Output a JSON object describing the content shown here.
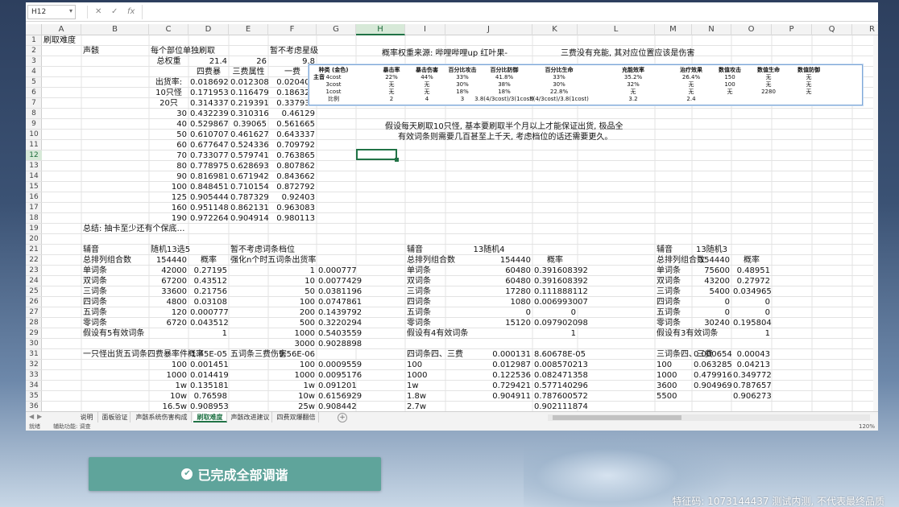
{
  "formula_bar": {
    "name_box": "H12",
    "fx": "fx"
  },
  "columns": [
    "A",
    "B",
    "C",
    "D",
    "E",
    "F",
    "G",
    "H",
    "I",
    "J",
    "K",
    "L",
    "M",
    "N",
    "O",
    "P",
    "Q",
    "R",
    "S",
    "T"
  ],
  "active_cell": "H12",
  "rows": [
    "1",
    "2",
    "3",
    "4",
    "5",
    "6",
    "7",
    "8",
    "9",
    "10",
    "11",
    "12",
    "13",
    "14",
    "15",
    "16",
    "17",
    "18",
    "19",
    "20",
    "21",
    "22",
    "23",
    "24",
    "25",
    "26",
    "27",
    "28",
    "29",
    "30",
    "31",
    "32",
    "33",
    "34",
    "35",
    "36"
  ],
  "cells": {
    "A1": "刷取难度",
    "B2": "声骸",
    "C2": "每个部位单独刷取",
    "F2": "暂不考虑星级",
    "C3": "总权重",
    "D3": "21.4",
    "E3": "26",
    "F3": "9.8",
    "D4": "四费暴",
    "E4": "三费属性",
    "F4": "一费",
    "C5": "出货率:",
    "D5": "0.018692",
    "E5": "0.012308",
    "F5": "0.020408",
    "C6": "10只怪",
    "D6": "0.171953",
    "E6": "0.116479",
    "F6": "0.186324",
    "C7": "20只",
    "D7": "0.314337",
    "E7": "0.219391",
    "F7": "0.337931",
    "C8": "30",
    "D8": "0.432239",
    "E8": "0.310316",
    "F8": "0.46129",
    "C9": "40",
    "D9": "0.529867",
    "E9": "0.39065",
    "F9": "0.561665",
    "C10": "50",
    "D10": "0.610707",
    "E10": "0.461627",
    "F10": "0.643337",
    "C11": "60",
    "D11": "0.677647",
    "E11": "0.524336",
    "F11": "0.709792",
    "C12": "70",
    "D12": "0.733077",
    "E12": "0.579741",
    "F12": "0.763865",
    "C13": "80",
    "D13": "0.778975",
    "E13": "0.628693",
    "F13": "0.807862",
    "C14": "90",
    "D14": "0.816981",
    "E14": "0.671942",
    "F14": "0.843662",
    "C15": "100",
    "D15": "0.848451",
    "E15": "0.710154",
    "F15": "0.872792",
    "C16": "125",
    "D16": "0.905444",
    "E16": "0.787329",
    "F16": "0.92403",
    "C17": "160",
    "D17": "0.951148",
    "E17": "0.862131",
    "F17": "0.963083",
    "C18": "190",
    "D18": "0.972264",
    "E18": "0.904914",
    "F18": "0.980113",
    "B20": "总结: 抽卡至少还有个保底…",
    "B22": "辅音",
    "C22": "随机13选5",
    "E22": "暂不考虑词条档位",
    "B23": "总排列组合数",
    "C23": "154440",
    "D23": "概率",
    "E23": "强化n个时五词条出货率",
    "B24": "单词条",
    "C24": "42000",
    "D24": "0.27195",
    "F24": "1",
    "F24b": "0.000777",
    "B25": "双词条",
    "C25": "67200",
    "D25": "0.43512",
    "F25": "10",
    "F25b": "0.0077429",
    "B26": "三词条",
    "C26": "33600",
    "D26": "0.21756",
    "F26": "50",
    "F26b": "0.0381196",
    "B27": "四词条",
    "C27": "4800",
    "D27": "0.03108",
    "F27": "100",
    "F27b": "0.0747861",
    "B28": "五词条",
    "C28": "120",
    "D28": "0.000777",
    "F28": "200",
    "F28b": "0.1439792",
    "B29": "零词条",
    "C29": "6720",
    "D29": "0.043512",
    "F29": "500",
    "F29b": "0.3220294",
    "B30": "假设有5有效词条",
    "D30": "1",
    "F30": "1000",
    "F30b": "0.5403559",
    "F31": "3000",
    "F31b": "0.9028898",
    "B32": "一只怪出货五词条四费暴率件概率",
    "D32": "1.45E-05",
    "E32": "五词条三费伤害",
    "F32": "9.56E-06",
    "C33": "100",
    "D33": "0.001451",
    "F33": "100",
    "F33b": "0.0009559",
    "C34": "1000",
    "D34": "0.014419",
    "F34": "1000",
    "F34b": "0.0095176",
    "C35": "1w",
    "D35": "0.135181",
    "F35": "1w",
    "F35b": "0.091201",
    "C36": "10w",
    "D36": "0.76598",
    "F36": "10w",
    "F36b": "0.6156929",
    "C37": "16.5w",
    "D37": "0.908953",
    "F37": "25w",
    "F37b": "0.908442",
    "I22": "辅音",
    "J22": "13随机4",
    "I23": "总排列组合数",
    "J23": "154440",
    "K23": "概率",
    "I24": "单词条",
    "J24": "60480",
    "K24": "0.391608392",
    "I25": "双词条",
    "J25": "60480",
    "K25": "0.391608392",
    "I26": "三词条",
    "J26": "17280",
    "K26": "0.111888112",
    "I27": "四词条",
    "J27": "1080",
    "K27": "0.006993007",
    "I28": "五词条",
    "J28": "0",
    "K28": "0",
    "I29": "零词条",
    "J29": "15120",
    "K29": "0.097902098",
    "I30": "假设有4有效词条",
    "K30": "1",
    "I32": "四词条四、三费",
    "J32": "0.000131",
    "K32": "8.60678E-05",
    "I33": "100",
    "J33": "0.012987",
    "K33": "0.008570213",
    "I34": "1000",
    "J34": "0.122536",
    "K34": "0.082471358",
    "I35": "1w",
    "J35": "0.729421",
    "K35": "0.577140296",
    "I36": "1.8w",
    "J36": "0.904911",
    "K36": "0.787600572",
    "I37": "2.7w",
    "K37": "0.902111874",
    "M22": "辅音",
    "N22": "13随机3",
    "M23": "总排列组合数",
    "N23": "154440",
    "O23": "概率",
    "M24": "单词条",
    "N24": "75600",
    "O24": "0.48951",
    "M25": "双词条",
    "N25": "43200",
    "O25": "0.27972",
    "M26": "三词条",
    "N26": "5400",
    "O26": "0.034965",
    "M27": "四词条",
    "N27": "0",
    "O27": "0",
    "M28": "五词条",
    "N28": "0",
    "O28": "0",
    "M29": "零词条",
    "N29": "30240",
    "O29": "0.195804",
    "M30": "假设有3有效词条",
    "O30": "1",
    "M32": "三词条四、三费",
    "N32": "0.000654",
    "O32": "0.00043",
    "M33": "100",
    "N33": "0.063285",
    "O33": "0.04213",
    "M34": "1000",
    "N34": "0.479916",
    "O34": "0.349772",
    "M35": "3600",
    "N35": "0.904969",
    "O35": "0.787657",
    "M36": "5500",
    "O36": "0.906273"
  },
  "notes": {
    "row2": "概率权重来源: 哔哩哔哩up 红叶果-",
    "row2b": "三费没有充能, 其对应位置应该是伤害",
    "row9": "假设每天刷取10只怪, 基本要刷取半个月以上才能保证出货, 极品全",
    "row10": "有效词条则需要几百甚至上千天, 考虑档位的话还需要更久。"
  },
  "embedded_table": {
    "headers": [
      "种类 (金色)",
      "暴击率",
      "暴击伤害",
      "百分比攻击",
      "百分比防御",
      "百分比生命",
      "充能效率",
      "治疗效果",
      "数值攻击",
      "数值生命",
      "数值防御"
    ],
    "row_label": "主音",
    "rows": [
      [
        "4cost",
        "22%",
        "44%",
        "33%",
        "41.8%",
        "33%",
        "35.2%",
        "26.4%",
        "150",
        "无",
        "无"
      ],
      [
        "3cost",
        "无",
        "无",
        "30%",
        "38%",
        "30%",
        "32%",
        "无",
        "100",
        "无",
        "无"
      ],
      [
        "1cost",
        "无",
        "无",
        "18%",
        "18%",
        "22.8%",
        "无",
        "无",
        "无",
        "2280",
        "无"
      ],
      [
        "比例",
        "2",
        "4",
        "3",
        "3.8(4/3cost)/3(1cost)",
        "3(4/3cost)/3.8(1cost)",
        "3.2",
        "2.4",
        "",
        "",
        ""
      ]
    ]
  },
  "sheet_tabs": [
    "说明",
    "面板验证",
    "声骸系统伤害构成",
    "刷取难度",
    "声骸改进建议",
    "四费双爆翻倍"
  ],
  "active_tab": "刷取难度",
  "status": {
    "left": "就绪",
    "acc": "辅助功能: 调查",
    "zoom": "120%"
  },
  "button": {
    "label": "已完成全部调谐"
  },
  "watermark": "特征码: 1073144437  测试内测, 不代表最终品质"
}
